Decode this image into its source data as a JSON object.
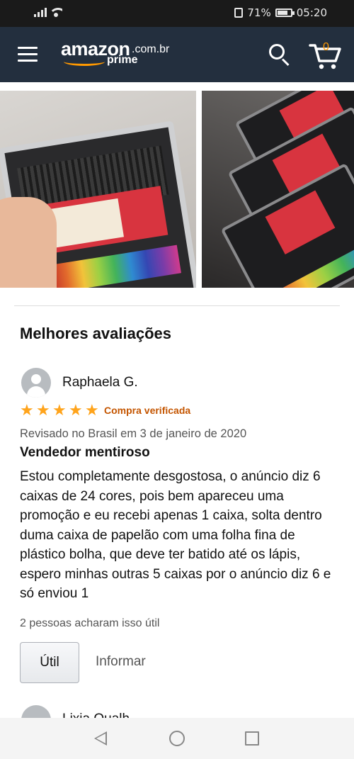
{
  "status_bar": {
    "battery_text": "71%",
    "time": "05:20",
    "icons": [
      "signal-icon",
      "wifi-icon",
      "vibrate-icon",
      "battery-icon"
    ]
  },
  "header": {
    "logo_word": "amazon",
    "logo_tld": ".com.br",
    "logo_prime": "prime",
    "cart_count": "0",
    "brand_colors": {
      "navy": "#232f3e",
      "orange": "#ff9900"
    }
  },
  "reviews_section": {
    "title": "Melhores avaliações",
    "review": {
      "reviewer": "Raphaela G.",
      "rating": 5,
      "stars": [
        "★",
        "★",
        "★",
        "★",
        "★"
      ],
      "verified": "Compra verificada",
      "date": "Revisado no Brasil em 3 de janeiro de 2020",
      "title": "Vendedor mentiroso",
      "body": "Estou completamente desgostosa, o anúncio diz 6 caixas de 24 cores, pois bem apareceu uma promoção e eu recebi apenas 1 caixa, solta dentro duma caixa de papelão com uma folha fina de plástico bolha, que deve ter batido até os lápis, espero minhas outras 5 caixas por o anúncio diz 6 e só enviou 1",
      "helpful_count": "2 pessoas acharam isso útil",
      "helpful_button": "Útil",
      "report_link": "Informar"
    },
    "next_reviewer_partial": "Lixia Qualh..."
  },
  "colors": {
    "star": "#ffa41c",
    "verified": "#c45500"
  }
}
